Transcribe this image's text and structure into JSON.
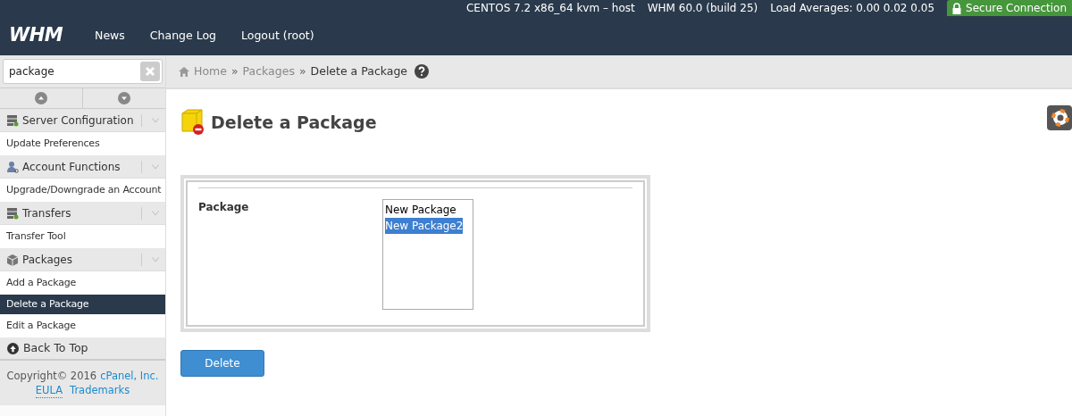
{
  "top_bar": {
    "server": "CENTOS 7.2 x86_64 kvm – host",
    "version": "WHM 60.0 (build 25)",
    "load": "Load Averages: 0.00 0.02 0.05",
    "secure": "Secure Connection"
  },
  "nav": {
    "logo": "WHM",
    "links": [
      "News",
      "Change Log",
      "Logout (root)"
    ]
  },
  "search": {
    "value": "package"
  },
  "sidebar": {
    "items": [
      {
        "kind": "server",
        "label": "Server Configuration"
      },
      {
        "kind": "link",
        "label": "Update Preferences",
        "selected": false
      },
      {
        "kind": "user",
        "label": "Account Functions"
      },
      {
        "kind": "link",
        "label": "Upgrade/Downgrade an Account",
        "selected": false
      },
      {
        "kind": "server",
        "label": "Transfers"
      },
      {
        "kind": "link",
        "label": "Transfer Tool",
        "selected": false
      },
      {
        "kind": "box",
        "label": "Packages"
      },
      {
        "kind": "link",
        "label": "Add a Package",
        "selected": false
      },
      {
        "kind": "link",
        "label": "Delete a Package",
        "selected": true
      },
      {
        "kind": "link",
        "label": "Edit a Package",
        "selected": false
      }
    ],
    "back_to_top": "Back To Top",
    "footer": {
      "copyright": "Copyright© 2016",
      "company": "cPanel, Inc.",
      "links": [
        "EULA",
        "Trademarks"
      ]
    }
  },
  "breadcrumb": {
    "items": [
      "Home",
      "Packages",
      "Delete a Package"
    ],
    "separator": "»"
  },
  "page": {
    "title": "Delete a Package",
    "field_label": "Package",
    "options": [
      {
        "label": "New Package",
        "selected": false
      },
      {
        "label": "New Package2",
        "selected": true
      }
    ],
    "button": "Delete"
  }
}
